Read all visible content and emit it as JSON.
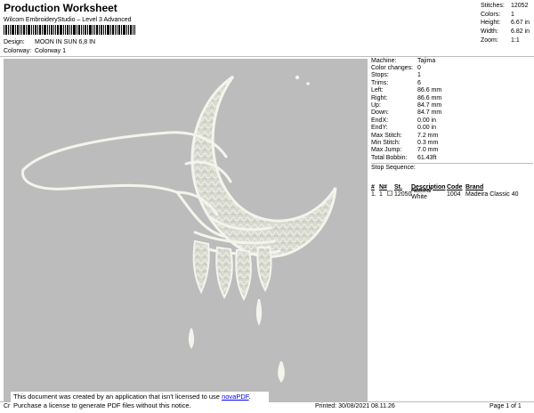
{
  "header": {
    "title": "Production Worksheet",
    "subtitle": "Wilcom EmbroideryStudio – Level 3 Advanced",
    "design_label": "Design:",
    "design_value": "MOON IN SUN 6,8 IN",
    "colorway_label": "Colorway:",
    "colorway_value": "Colorway 1"
  },
  "stats": [
    {
      "label": "Stitches:",
      "value": "12052"
    },
    {
      "label": "Colors:",
      "value": "1"
    },
    {
      "label": "Height:",
      "value": "6.67 in"
    },
    {
      "label": "Width:",
      "value": "6.82 in"
    },
    {
      "label": "Zoom:",
      "value": "1:1"
    }
  ],
  "machine_info": [
    {
      "label": "Machine:",
      "value": "Tajima"
    },
    {
      "label": "Color changes:",
      "value": "0"
    },
    {
      "label": "Stops:",
      "value": "1"
    },
    {
      "label": "Trims:",
      "value": "6"
    },
    {
      "label": "Left:",
      "value": "86.6 mm"
    },
    {
      "label": "Right:",
      "value": "86.6 mm"
    },
    {
      "label": "Up:",
      "value": "84.7 mm"
    },
    {
      "label": "Down:",
      "value": "84.7 mm"
    },
    {
      "label": "EndX:",
      "value": "0.00 in"
    },
    {
      "label": "EndY:",
      "value": "0.00 in"
    },
    {
      "label": "Max Stitch:",
      "value": "7.2 mm"
    },
    {
      "label": "Min Stitch:",
      "value": "0.3 mm"
    },
    {
      "label": "Max Jump:",
      "value": "7.0 mm"
    },
    {
      "label": "Total Bobbin:",
      "value": "61.43ft"
    }
  ],
  "stop_sequence": {
    "label": "Stop Sequence:",
    "columns": [
      "#",
      "N#",
      "St.",
      "Description",
      "Code",
      "Brand"
    ],
    "rows": [
      {
        "num": "1.",
        "n": "1",
        "st": "12050",
        "description": "Natural White",
        "code": "1004",
        "brand": "Madeira Classic 40"
      }
    ]
  },
  "footer": {
    "cr": "Cr",
    "printed": "Printed: 30/08/2021 08.11.26",
    "page": "Page 1 of 1"
  },
  "notice": {
    "line1_prefix": "This document was created by an application that isn't licensed to use ",
    "link": "novaPDF",
    "line1_suffix": ".",
    "line2": "Purchase a license to generate PDF files without this notice."
  },
  "colors": {
    "design_background": "#bcbcbc",
    "thread": "#eef0e4"
  }
}
